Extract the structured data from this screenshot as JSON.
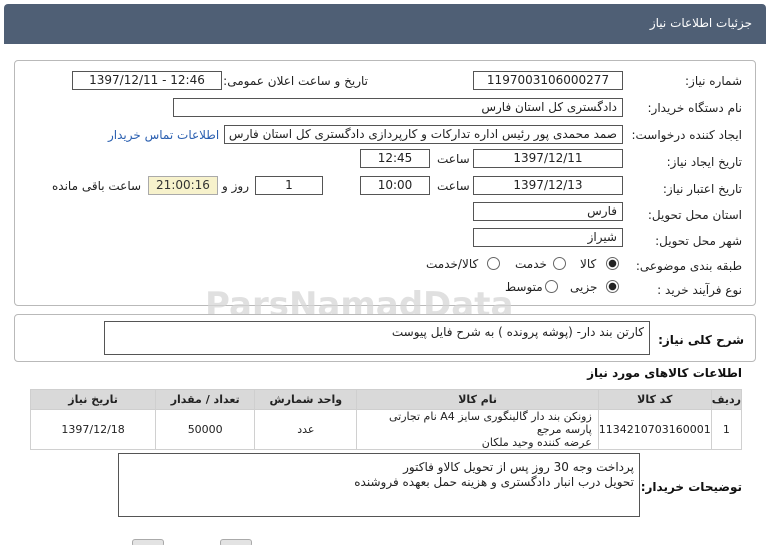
{
  "header": {
    "title": "جزئیات اطلاعات نیاز"
  },
  "info": {
    "need_number_label": "شماره نیاز:",
    "need_number": "1197003106000277",
    "announce_label": "تاریخ و ساعت اعلان عمومی:",
    "announce_value": "1397/12/11 - 12:46",
    "buyer_org_label": "نام دستگاه خریدار:",
    "buyer_org": "دادگستری کل استان فارس",
    "requester_label": "ایجاد کننده درخواست:",
    "requester": "صمد محمدی پور رئیس اداره تدارکات و کارپردازی دادگستری کل استان فارس",
    "contact_link": "اطلاعات تماس خریدار",
    "created_label": "تاریخ ایجاد نیاز:",
    "created_date": "1397/12/11",
    "created_time_label": "ساعت",
    "created_time": "12:45",
    "validity_label": "تاریخ اعتبار نیاز:",
    "validity_date": "1397/12/13",
    "validity_time_label": "ساعت",
    "validity_time": "10:00",
    "days_value": "1",
    "days_label": "روز و",
    "remaining_time": "21:00:16",
    "remaining_label": "ساعت باقی مانده",
    "province_label": "استان محل تحویل:",
    "province": "فارس",
    "city_label": "شهر محل تحویل:",
    "city": "شیراز",
    "category_label": "طبقه بندی موضوعی:",
    "category_options": [
      "کالا",
      "خدمت",
      "کالا/خدمت"
    ],
    "process_label": "نوع فرآیند خرید :",
    "process_options": [
      "جزیی",
      "متوسط"
    ]
  },
  "summary": {
    "label": "شرح کلی نیاز:",
    "text": "کارتن بند دار- (پوشه پرونده ) به شرح فایل پیوست"
  },
  "goods": {
    "title": "اطلاعات کالاهای مورد نیاز",
    "headers": [
      "ردیف",
      "کد کالا",
      "نام کالا",
      "واحد شمارش",
      "تعداد / مقدار",
      "تاریخ نیاز"
    ],
    "rows": [
      {
        "index": "1",
        "code": "1134210703160001",
        "name_line1": "زونکن بند دار گالینگوری سایز A4 نام تجارتی پارسه مرجع",
        "name_line2": "عرضه کننده وحید ملکان",
        "unit": "عدد",
        "qty": "50000",
        "date": "1397/12/18"
      }
    ]
  },
  "buyer_notes": {
    "label": "توضیحات خریدار:",
    "line1": "پرداخت وجه 30 روز پس از تحویل کالاو فاکتور",
    "line2": "تحویل درب انبار دادگستری و هزینه حمل بعهده فروشنده"
  },
  "colors": {
    "header_bg": "#4f5f75",
    "link": "#2a5fb0",
    "remaining_bg": "#f7f2cc"
  }
}
